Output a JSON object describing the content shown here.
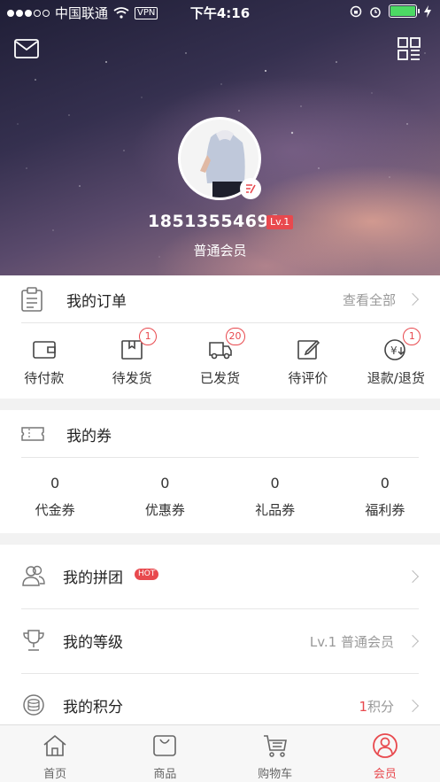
{
  "status_bar": {
    "carrier": "中国联通",
    "vpn": "VPN",
    "time": "下午4:16"
  },
  "profile": {
    "phone": "18513554691",
    "level": "Lv.1",
    "member_type": "普通会员"
  },
  "orders": {
    "title": "我的订单",
    "view_all": "查看全部",
    "items": [
      {
        "label": "待付款",
        "icon": "wallet-icon",
        "badge": ""
      },
      {
        "label": "待发货",
        "icon": "package-icon",
        "badge": "1"
      },
      {
        "label": "已发货",
        "icon": "truck-icon",
        "badge": "20"
      },
      {
        "label": "待评价",
        "icon": "edit-icon",
        "badge": ""
      },
      {
        "label": "退款/退货",
        "icon": "refund-icon",
        "badge": "1"
      }
    ]
  },
  "coupons": {
    "title": "我的券",
    "items": [
      {
        "count": "0",
        "label": "代金券"
      },
      {
        "count": "0",
        "label": "优惠券"
      },
      {
        "count": "0",
        "label": "礼品券"
      },
      {
        "count": "0",
        "label": "福利券"
      }
    ]
  },
  "menu": {
    "group_buy": {
      "title": "我的拼团",
      "hot": "HOT"
    },
    "level": {
      "title": "我的等级",
      "value": "Lv.1 普通会员"
    },
    "points": {
      "title": "我的积分",
      "count": "1",
      "unit": "积分"
    }
  },
  "tabs": [
    {
      "label": "首页",
      "icon": "home-icon"
    },
    {
      "label": "商品",
      "icon": "bag-icon"
    },
    {
      "label": "购物车",
      "icon": "cart-icon"
    },
    {
      "label": "会员",
      "icon": "user-icon"
    }
  ],
  "colors": {
    "accent": "#e8494e",
    "battery": "#4cd964"
  }
}
